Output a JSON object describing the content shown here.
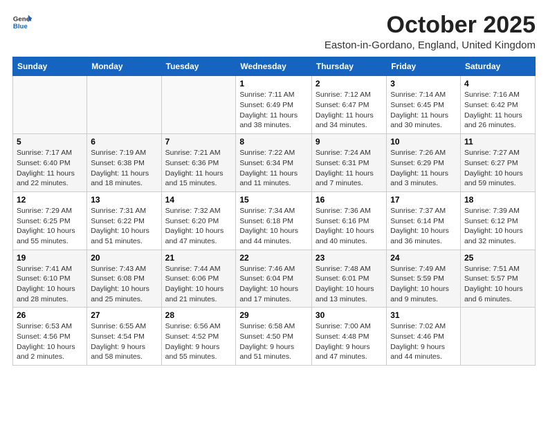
{
  "header": {
    "logo_general": "General",
    "logo_blue": "Blue",
    "title": "October 2025",
    "subtitle": "Easton-in-Gordano, England, United Kingdom"
  },
  "weekdays": [
    "Sunday",
    "Monday",
    "Tuesday",
    "Wednesday",
    "Thursday",
    "Friday",
    "Saturday"
  ],
  "weeks": [
    [
      {
        "day": "",
        "info": ""
      },
      {
        "day": "",
        "info": ""
      },
      {
        "day": "",
        "info": ""
      },
      {
        "day": "1",
        "info": "Sunrise: 7:11 AM\nSunset: 6:49 PM\nDaylight: 11 hours\nand 38 minutes."
      },
      {
        "day": "2",
        "info": "Sunrise: 7:12 AM\nSunset: 6:47 PM\nDaylight: 11 hours\nand 34 minutes."
      },
      {
        "day": "3",
        "info": "Sunrise: 7:14 AM\nSunset: 6:45 PM\nDaylight: 11 hours\nand 30 minutes."
      },
      {
        "day": "4",
        "info": "Sunrise: 7:16 AM\nSunset: 6:42 PM\nDaylight: 11 hours\nand 26 minutes."
      }
    ],
    [
      {
        "day": "5",
        "info": "Sunrise: 7:17 AM\nSunset: 6:40 PM\nDaylight: 11 hours\nand 22 minutes."
      },
      {
        "day": "6",
        "info": "Sunrise: 7:19 AM\nSunset: 6:38 PM\nDaylight: 11 hours\nand 18 minutes."
      },
      {
        "day": "7",
        "info": "Sunrise: 7:21 AM\nSunset: 6:36 PM\nDaylight: 11 hours\nand 15 minutes."
      },
      {
        "day": "8",
        "info": "Sunrise: 7:22 AM\nSunset: 6:34 PM\nDaylight: 11 hours\nand 11 minutes."
      },
      {
        "day": "9",
        "info": "Sunrise: 7:24 AM\nSunset: 6:31 PM\nDaylight: 11 hours\nand 7 minutes."
      },
      {
        "day": "10",
        "info": "Sunrise: 7:26 AM\nSunset: 6:29 PM\nDaylight: 11 hours\nand 3 minutes."
      },
      {
        "day": "11",
        "info": "Sunrise: 7:27 AM\nSunset: 6:27 PM\nDaylight: 10 hours\nand 59 minutes."
      }
    ],
    [
      {
        "day": "12",
        "info": "Sunrise: 7:29 AM\nSunset: 6:25 PM\nDaylight: 10 hours\nand 55 minutes."
      },
      {
        "day": "13",
        "info": "Sunrise: 7:31 AM\nSunset: 6:22 PM\nDaylight: 10 hours\nand 51 minutes."
      },
      {
        "day": "14",
        "info": "Sunrise: 7:32 AM\nSunset: 6:20 PM\nDaylight: 10 hours\nand 47 minutes."
      },
      {
        "day": "15",
        "info": "Sunrise: 7:34 AM\nSunset: 6:18 PM\nDaylight: 10 hours\nand 44 minutes."
      },
      {
        "day": "16",
        "info": "Sunrise: 7:36 AM\nSunset: 6:16 PM\nDaylight: 10 hours\nand 40 minutes."
      },
      {
        "day": "17",
        "info": "Sunrise: 7:37 AM\nSunset: 6:14 PM\nDaylight: 10 hours\nand 36 minutes."
      },
      {
        "day": "18",
        "info": "Sunrise: 7:39 AM\nSunset: 6:12 PM\nDaylight: 10 hours\nand 32 minutes."
      }
    ],
    [
      {
        "day": "19",
        "info": "Sunrise: 7:41 AM\nSunset: 6:10 PM\nDaylight: 10 hours\nand 28 minutes."
      },
      {
        "day": "20",
        "info": "Sunrise: 7:43 AM\nSunset: 6:08 PM\nDaylight: 10 hours\nand 25 minutes."
      },
      {
        "day": "21",
        "info": "Sunrise: 7:44 AM\nSunset: 6:06 PM\nDaylight: 10 hours\nand 21 minutes."
      },
      {
        "day": "22",
        "info": "Sunrise: 7:46 AM\nSunset: 6:04 PM\nDaylight: 10 hours\nand 17 minutes."
      },
      {
        "day": "23",
        "info": "Sunrise: 7:48 AM\nSunset: 6:01 PM\nDaylight: 10 hours\nand 13 minutes."
      },
      {
        "day": "24",
        "info": "Sunrise: 7:49 AM\nSunset: 5:59 PM\nDaylight: 10 hours\nand 9 minutes."
      },
      {
        "day": "25",
        "info": "Sunrise: 7:51 AM\nSunset: 5:57 PM\nDaylight: 10 hours\nand 6 minutes."
      }
    ],
    [
      {
        "day": "26",
        "info": "Sunrise: 6:53 AM\nSunset: 4:56 PM\nDaylight: 10 hours\nand 2 minutes."
      },
      {
        "day": "27",
        "info": "Sunrise: 6:55 AM\nSunset: 4:54 PM\nDaylight: 9 hours\nand 58 minutes."
      },
      {
        "day": "28",
        "info": "Sunrise: 6:56 AM\nSunset: 4:52 PM\nDaylight: 9 hours\nand 55 minutes."
      },
      {
        "day": "29",
        "info": "Sunrise: 6:58 AM\nSunset: 4:50 PM\nDaylight: 9 hours\nand 51 minutes."
      },
      {
        "day": "30",
        "info": "Sunrise: 7:00 AM\nSunset: 4:48 PM\nDaylight: 9 hours\nand 47 minutes."
      },
      {
        "day": "31",
        "info": "Sunrise: 7:02 AM\nSunset: 4:46 PM\nDaylight: 9 hours\nand 44 minutes."
      },
      {
        "day": "",
        "info": ""
      }
    ]
  ]
}
